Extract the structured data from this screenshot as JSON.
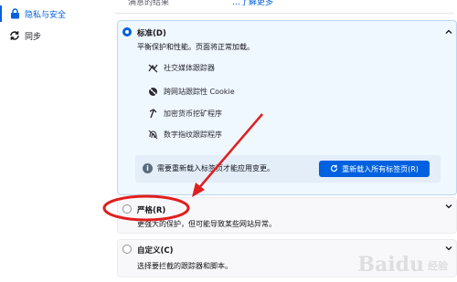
{
  "sidebar": {
    "items": [
      {
        "label": "隐私与安全",
        "icon": "lock-icon",
        "active": true
      },
      {
        "label": "同步",
        "icon": "sync-icon",
        "active": false
      }
    ]
  },
  "topcut": {
    "left": "满意的结果",
    "right": "…了解更多"
  },
  "protection": {
    "standard": {
      "title": "标准(D)",
      "desc": "平衡保护和性能。页面将正常加载。",
      "features": [
        {
          "label": "社交媒体跟踪器",
          "icon": "social-tracker-icon"
        },
        {
          "label": "跨网站跟踪性 Cookie",
          "icon": "cookie-icon"
        },
        {
          "label": "加密货币挖矿程序",
          "icon": "cryptominer-icon"
        },
        {
          "label": "数字指纹跟踪程序",
          "icon": "fingerprint-icon"
        }
      ],
      "notice": "需要重新载入标签页才能应用变更。",
      "reload_button": "重新载入所有标签页(R)"
    },
    "strict": {
      "title": "严格(R)",
      "desc": "更强大的保护，但可能导致某些网站异常。"
    },
    "custom": {
      "title": "自定义(C)",
      "desc": "选择要拦截的跟踪器和脚本。"
    }
  },
  "watermark": {
    "text": "Baidu",
    "sub": "经验"
  },
  "colors": {
    "accent": "#0061e0",
    "annotation": "#e01e1e"
  }
}
